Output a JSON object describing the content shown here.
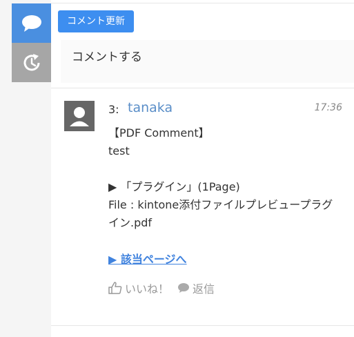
{
  "sidebar": {
    "tabs": [
      {
        "name": "comments",
        "icon": "speech-bubble-icon",
        "color": "#4a8fe0"
      },
      {
        "name": "history",
        "icon": "history-icon",
        "color": "#a6a6a6"
      }
    ]
  },
  "header": {
    "update_button_label": "コメント更新",
    "comment_input_placeholder": "コメントする"
  },
  "comment": {
    "number": "3:",
    "author": "tanaka",
    "time": "17:36",
    "lines": {
      "l1": "【PDF Comment】",
      "l2": "test",
      "l3": "",
      "l4": "▶ 「プラグイン」(1Page)",
      "l5": "File : kintone添付ファイルプレビュープラグ",
      "l6": "イン.pdf"
    },
    "jump_link": "▶ 該当ページへ",
    "like_label": "いいね！",
    "reply_label": "返信"
  }
}
